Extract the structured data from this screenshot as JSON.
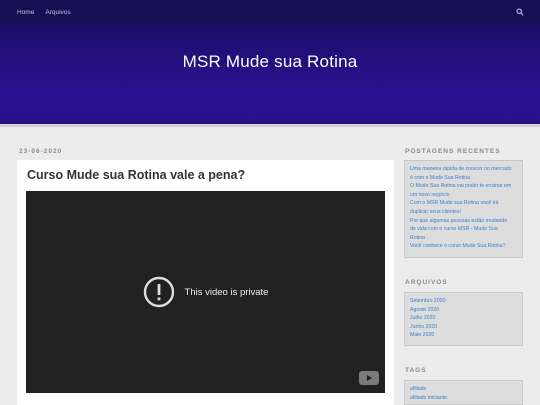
{
  "nav": {
    "items": [
      {
        "label": "Home"
      },
      {
        "label": "Arquivos"
      }
    ]
  },
  "site": {
    "title": "MSR Mude sua Rotina"
  },
  "post": {
    "date": "23-06-2020",
    "title": "Curso Mude sua Rotina vale a pena?",
    "video_message": "This video is private"
  },
  "sidebar": {
    "recent": {
      "title": "POSTAGENS RECENTES",
      "lines": [
        "Uma maneira rápida de crescer no mercado",
        "é com o Mude Sua Rotina",
        "O Mude Sua Rotina vai poder te ensinar em",
        "um novo negócio",
        "Com o MSR Mude sua Rotina você irá",
        "duplicar seus clientes!",
        "Por que algumas pessoas estão mudando",
        "de vida com o curso MSR - Mude Sua",
        "Rotina",
        "Você conhece o curso Mude Sua Rotina?"
      ]
    },
    "archives": {
      "title": "ARQUIVOS",
      "items": [
        "Setembro 2020",
        "Agosto 2020",
        "Julho 2020",
        "Junho 2020",
        "Maio 2020"
      ]
    },
    "tags": {
      "title": "TAGS",
      "items": [
        "afiliado",
        "afiliado iniciante"
      ]
    }
  },
  "colors": {
    "nav_bg": "#160e52",
    "hero_bg": "#2a1090",
    "link": "#3a80c8"
  }
}
